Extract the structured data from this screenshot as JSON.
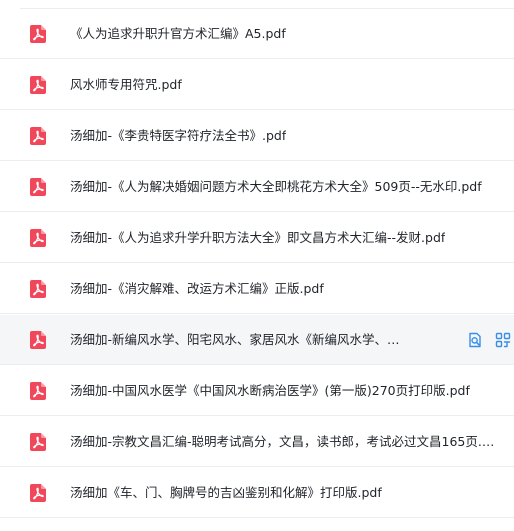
{
  "colors": {
    "pdf_icon": "#f0485a",
    "action_icon": "#3a8ee6",
    "row_border": "#ebedf0",
    "selected_row_bg": "#f4f6f8"
  },
  "icons": {
    "file_type": "pdf-file-icon",
    "row_actions": [
      "preview-icon",
      "share-icon"
    ]
  },
  "files": [
    {
      "name": "《人为追求升职升官方术汇编》A5.pdf"
    },
    {
      "name": "风水师专用符咒.pdf"
    },
    {
      "name": "汤细加-《李贵特医字符疗法全书》.pdf"
    },
    {
      "name": "汤细加-《人为解决婚姻问题方术大全即桃花方术大全》509页--无水印.pdf"
    },
    {
      "name": "汤细加-《人为追求升学升职方法大全》即文昌方术大汇编--发财.pdf"
    },
    {
      "name": "汤细加-《消灾解难、改运方术汇编》正版.pdf"
    },
    {
      "name": "汤细加-新编风水学、阳宅风水、家居风水《新编风水学、第...",
      "selected": true
    },
    {
      "name": "汤细加-中国风水医学《中国风水断病治医学》(第一版)270页打印版.pdf"
    },
    {
      "name": "汤细加-宗教文昌汇编-聪明考试高分，文昌，读书郎，考试必过文昌165页.pdf"
    },
    {
      "name": "汤细加《车、门、胸牌号的吉凶鉴别和化解》打印版.pdf"
    }
  ]
}
